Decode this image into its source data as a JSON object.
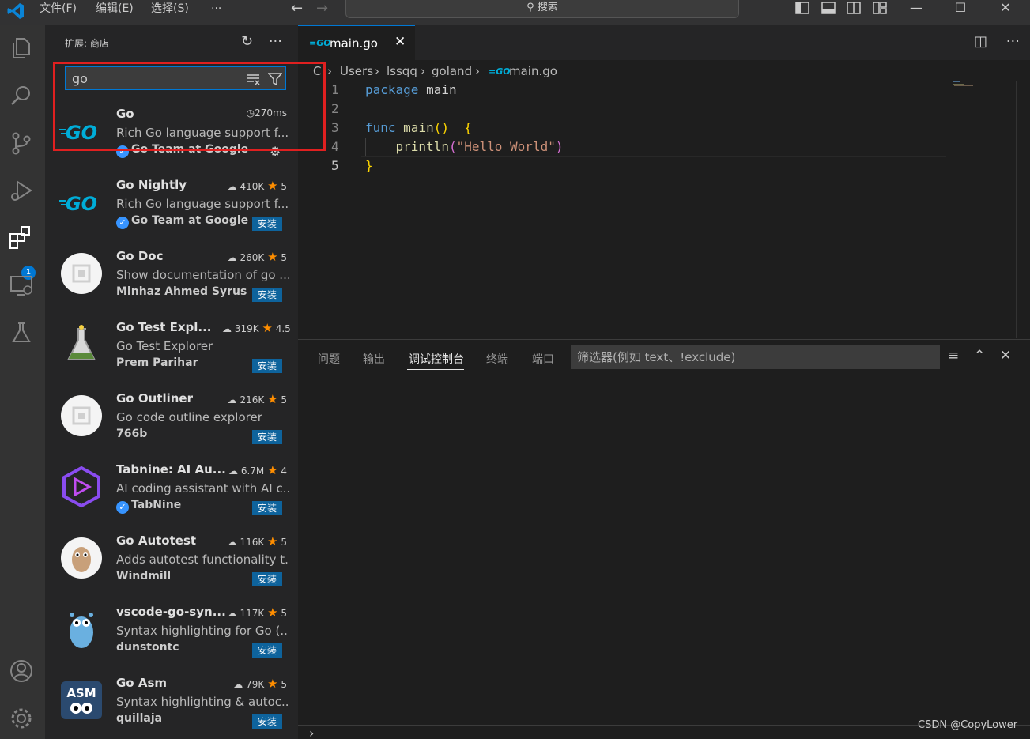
{
  "titlebar": {
    "menus": [
      "文件(F)",
      "编辑(E)",
      "选择(S)",
      "···"
    ],
    "search_label": "搜索"
  },
  "activity": {
    "extensions_badge": "1"
  },
  "sidebar": {
    "title": "扩展: 商店",
    "search_value": "go",
    "extensions": [
      {
        "name": "Go",
        "stats": "270ms",
        "rating": "",
        "description": "Rich Go language support f...",
        "publisher": "Go Team at Google",
        "verified": true,
        "action": ""
      },
      {
        "name": "Go Nightly",
        "stats": "410K",
        "rating": "5",
        "description": "Rich Go language support f...",
        "publisher": "Go Team at Google",
        "verified": true,
        "action": "安装"
      },
      {
        "name": "Go Doc",
        "stats": "260K",
        "rating": "5",
        "description": "Show documentation of go ...",
        "publisher": "Minhaz Ahmed Syrus",
        "verified": false,
        "action": "安装"
      },
      {
        "name": "Go Test Expl...",
        "stats": "319K",
        "rating": "4.5",
        "description": "Go Test Explorer",
        "publisher": "Prem Parihar",
        "verified": false,
        "action": "安装"
      },
      {
        "name": "Go Outliner",
        "stats": "216K",
        "rating": "5",
        "description": "Go code outline explorer",
        "publisher": "766b",
        "verified": false,
        "action": "安装"
      },
      {
        "name": "Tabnine: AI Au...",
        "stats": "6.7M",
        "rating": "4",
        "description": "AI coding assistant with AI c...",
        "publisher": "TabNine",
        "verified": true,
        "action": "安装"
      },
      {
        "name": "Go Autotest",
        "stats": "116K",
        "rating": "5",
        "description": "Adds autotest functionality t...",
        "publisher": "Windmill",
        "verified": false,
        "action": "安装"
      },
      {
        "name": "vscode-go-syn...",
        "stats": "117K",
        "rating": "5",
        "description": "Syntax highlighting for Go (...",
        "publisher": "dunstontc",
        "verified": false,
        "action": "安装"
      },
      {
        "name": "Go Asm",
        "stats": "79K",
        "rating": "5",
        "description": "Syntax highlighting & autoc...",
        "publisher": "quillaja",
        "verified": false,
        "action": "安装"
      }
    ]
  },
  "editor": {
    "tab_name": "main.go",
    "breadcrumb": [
      "C",
      "Users",
      "lssqq",
      "goland",
      "main.go"
    ],
    "line_numbers": [
      "1",
      "2",
      "3",
      "4",
      "5"
    ]
  },
  "panel": {
    "tabs": [
      "问题",
      "输出",
      "调试控制台",
      "终端",
      "端口"
    ],
    "active_tab": "调试控制台",
    "filter_placeholder": "筛选器(例如 text、!exclude)"
  },
  "watermark": "CSDN @CopyLower",
  "colors": {
    "accent": "#0078d4",
    "highlight_box": "#e02020",
    "install_button": "#0e639c"
  }
}
